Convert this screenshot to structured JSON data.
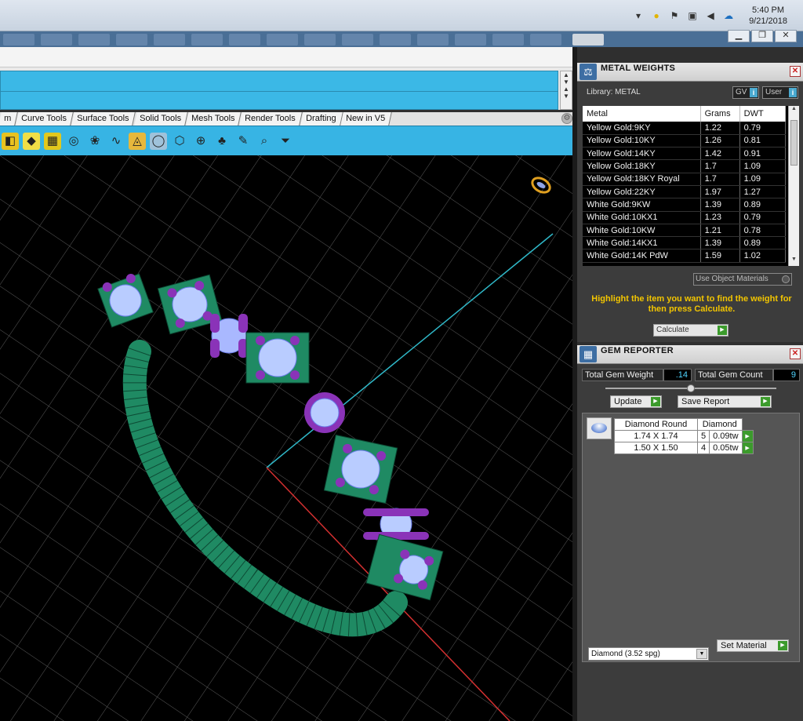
{
  "taskbar": {
    "clock_time": "5:40 PM",
    "clock_date": "9/21/2018",
    "tray_icons": [
      "up-arrow-icon",
      "norton-icon",
      "flag-icon",
      "network-icon",
      "volume-icon",
      "cloud-icon"
    ]
  },
  "window": {
    "minimize": "▁",
    "restore": "❐",
    "close": "✕"
  },
  "tabs": [
    "m",
    "Curve Tools",
    "Surface Tools",
    "Solid Tools",
    "Mesh Tools",
    "Render Tools",
    "Drafting",
    "New in V5"
  ],
  "toolbar_icons": [
    "◧",
    "◆",
    "▦",
    "◎",
    "❀",
    "∿",
    "◬",
    "◯",
    "⬡",
    "⊕",
    "♣",
    "✎",
    "⌕",
    "⏷"
  ],
  "metal_weights": {
    "title": "METAL WEIGHTS",
    "library_label": "Library: METAL",
    "gv_label": "GV",
    "user_label": "User",
    "columns": [
      "Metal",
      "Grams",
      "DWT"
    ],
    "rows": [
      [
        "Yellow Gold:9KY",
        "1.22",
        "0.79"
      ],
      [
        "Yellow Gold:10KY",
        "1.26",
        "0.81"
      ],
      [
        "Yellow Gold:14KY",
        "1.42",
        "0.91"
      ],
      [
        "Yellow Gold:18KY",
        "1.7",
        "1.09"
      ],
      [
        "Yellow Gold:18KY Royal",
        "1.7",
        "1.09"
      ],
      [
        "Yellow Gold:22KY",
        "1.97",
        "1.27"
      ],
      [
        "White Gold:9KW",
        "1.39",
        "0.89"
      ],
      [
        "White Gold:10KX1",
        "1.23",
        "0.79"
      ],
      [
        "White Gold:10KW",
        "1.21",
        "0.78"
      ],
      [
        "White Gold:14KX1",
        "1.39",
        "0.89"
      ],
      [
        "White Gold:14K PdW",
        "1.59",
        "1.02"
      ]
    ],
    "use_object_materials": "Use Object Materials",
    "hint": "Highlight the item you want to find the weight for then press Calculate.",
    "calculate": "Calculate"
  },
  "gem_reporter": {
    "title": "GEM REPORTER",
    "total_weight_label": "Total Gem Weight",
    "total_weight": ".14",
    "total_count_label": "Total Gem Count",
    "total_count": "9",
    "update": "Update",
    "save_report": "Save Report",
    "table_headers": [
      "Diamond Round",
      "Diamond"
    ],
    "rows": [
      [
        "1.74 X 1.74",
        "5",
        "0.09tw"
      ],
      [
        "1.50 X 1.50",
        "4",
        "0.05tw"
      ]
    ],
    "material": "Diamond     (3.52 spg)",
    "set_material": "Set Material"
  }
}
